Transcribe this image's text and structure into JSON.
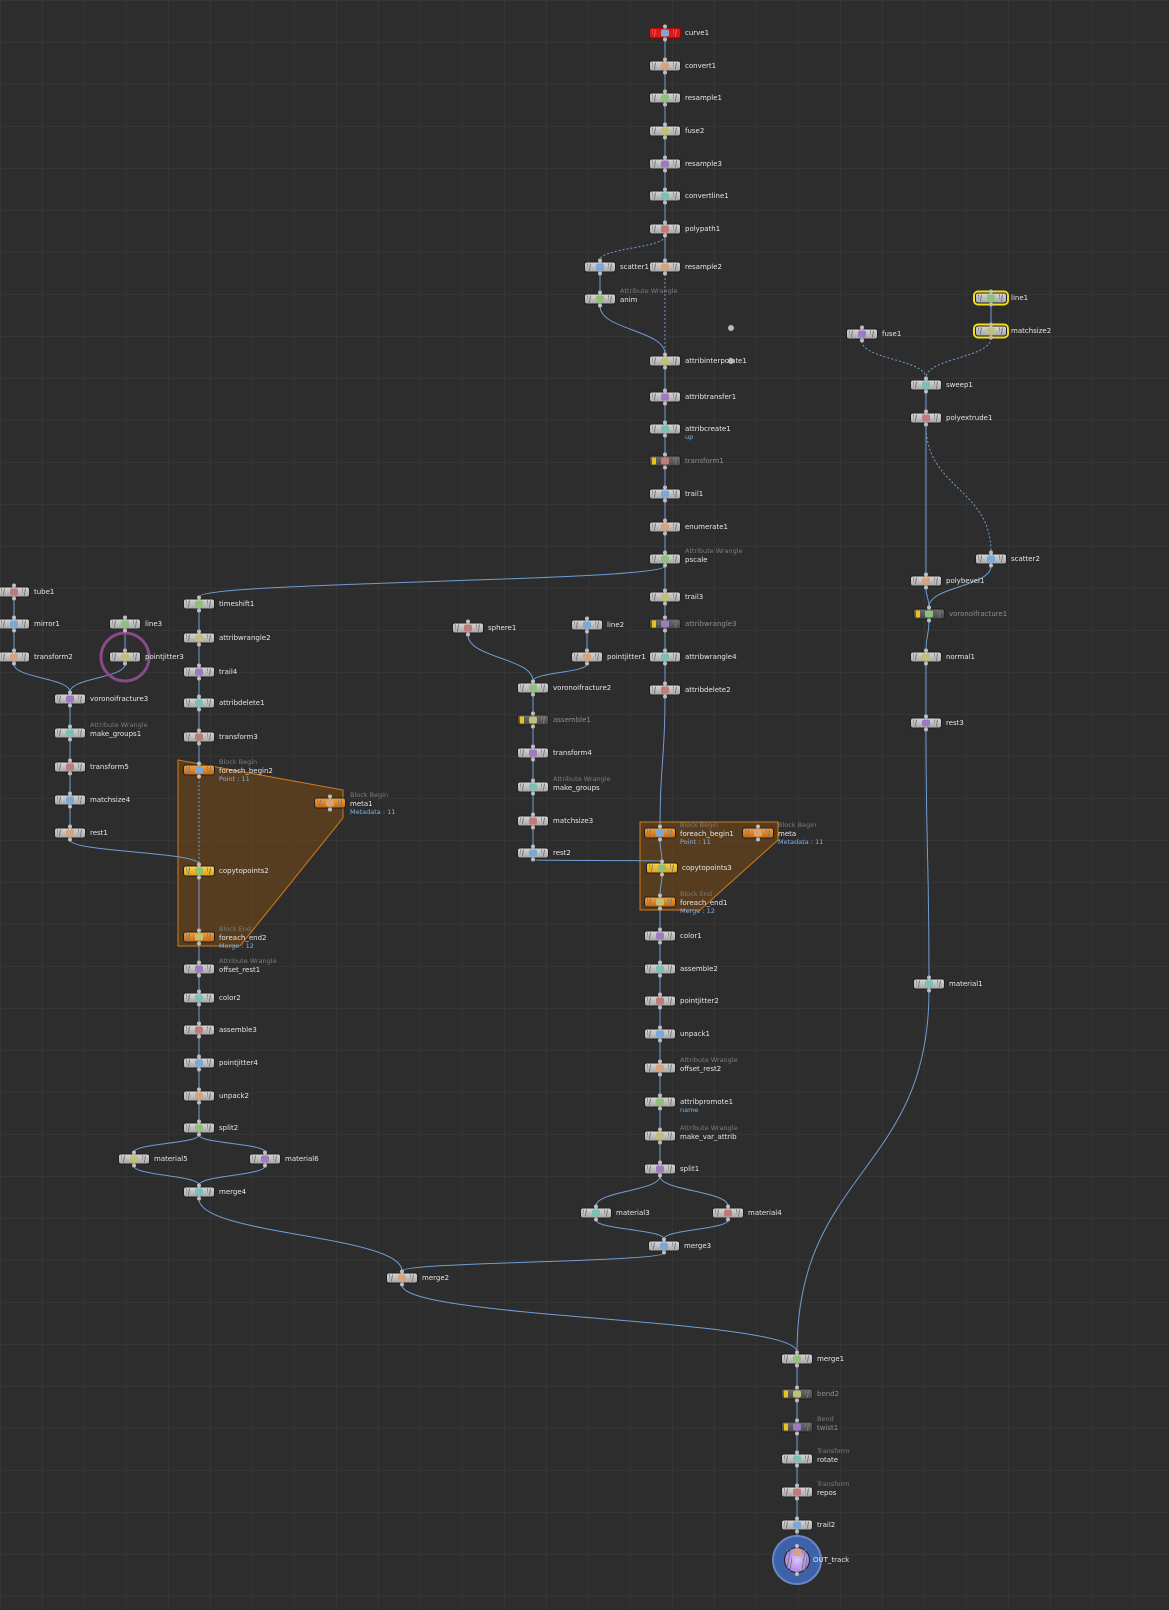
{
  "network": {
    "nodes": [
      {
        "id": "curve1",
        "label": "curve1",
        "style": "red"
      },
      {
        "id": "convert1",
        "label": "convert1"
      },
      {
        "id": "resample1",
        "label": "resample1"
      },
      {
        "id": "fuse2",
        "label": "fuse2"
      },
      {
        "id": "resample3",
        "label": "resample3"
      },
      {
        "id": "convertline1",
        "label": "convertline1"
      },
      {
        "id": "polypath1",
        "label": "polypath1"
      },
      {
        "id": "scatter1",
        "label": "scatter1"
      },
      {
        "id": "resample2",
        "label": "resample2"
      },
      {
        "id": "anim",
        "label": "anim",
        "type": "Attribute Wrangle"
      },
      {
        "id": "attribinterpolate1",
        "label": "attribinterpolate1"
      },
      {
        "id": "attribtransfer1",
        "label": "attribtransfer1"
      },
      {
        "id": "attribcreate1",
        "label": "attribcreate1",
        "sub": "up"
      },
      {
        "id": "transform1",
        "label": "transform1",
        "bypass": true
      },
      {
        "id": "trail1",
        "label": "trail1"
      },
      {
        "id": "enumerate1",
        "label": "enumerate1"
      },
      {
        "id": "pscale",
        "label": "pscale",
        "type": "Attribute Wrangle"
      },
      {
        "id": "trail3",
        "label": "trail3"
      },
      {
        "id": "attribwrangle3",
        "label": "attribwrangle3",
        "bypass": true
      },
      {
        "id": "attribwrangle4",
        "label": "attribwrangle4"
      },
      {
        "id": "attribdelete2",
        "label": "attribdelete2"
      },
      {
        "id": "foreach_begin1",
        "label": "foreach_begin1",
        "type": "Block Begin",
        "sub": "Point : 11",
        "style": "orange"
      },
      {
        "id": "meta",
        "label": "meta",
        "type": "Block Begin",
        "sub": "Metadata : 11",
        "style": "orange"
      },
      {
        "id": "copytopoints3",
        "label": "copytopoints3",
        "style": "yellow"
      },
      {
        "id": "foreach_end1",
        "label": "foreach_end1",
        "type": "Block End",
        "sub": "Merge : 12",
        "style": "orange"
      },
      {
        "id": "color1",
        "label": "color1"
      },
      {
        "id": "assemble2",
        "label": "assemble2"
      },
      {
        "id": "pointjitter2",
        "label": "pointjitter2"
      },
      {
        "id": "unpack1",
        "label": "unpack1"
      },
      {
        "id": "offset_rest2",
        "label": "offset_rest2",
        "type": "Attribute Wrangle"
      },
      {
        "id": "attribpromote1",
        "label": "attribpromote1",
        "sub": "name"
      },
      {
        "id": "make_var_attrib",
        "label": "make_var_attrib",
        "type": "Attribute Wrangle"
      },
      {
        "id": "split1",
        "label": "split1"
      },
      {
        "id": "material3",
        "label": "material3"
      },
      {
        "id": "material4",
        "label": "material4"
      },
      {
        "id": "merge3",
        "label": "merge3"
      },
      {
        "id": "merge2",
        "label": "merge2"
      },
      {
        "id": "merge1",
        "label": "merge1"
      },
      {
        "id": "bend2",
        "label": "bend2",
        "bypass": true
      },
      {
        "id": "twist1",
        "label": "twist1",
        "type": "Bend",
        "bypass": true
      },
      {
        "id": "rotate",
        "label": "rotate",
        "type": "Transform"
      },
      {
        "id": "repos",
        "label": "repos",
        "type": "Transform"
      },
      {
        "id": "trail2",
        "label": "trail2"
      },
      {
        "id": "OUT_track",
        "label": "OUT_track"
      },
      {
        "id": "line1",
        "label": "line1",
        "selected": true
      },
      {
        "id": "matchsize2",
        "label": "matchsize2",
        "selected": true
      },
      {
        "id": "fuse1",
        "label": "fuse1"
      },
      {
        "id": "sweep1",
        "label": "sweep1"
      },
      {
        "id": "polyextrude1",
        "label": "polyextrude1"
      },
      {
        "id": "scatter2",
        "label": "scatter2"
      },
      {
        "id": "polybevel1",
        "label": "polybevel1"
      },
      {
        "id": "voronoifracture1",
        "label": "voronoifracture1",
        "bypass": true
      },
      {
        "id": "normal1",
        "label": "normal1"
      },
      {
        "id": "rest3",
        "label": "rest3"
      },
      {
        "id": "material1",
        "label": "material1"
      },
      {
        "id": "tube1",
        "label": "tube1"
      },
      {
        "id": "mirror1",
        "label": "mirror1"
      },
      {
        "id": "transform2",
        "label": "transform2"
      },
      {
        "id": "line3",
        "label": "line3"
      },
      {
        "id": "pointjitter3",
        "label": "pointjitter3"
      },
      {
        "id": "voronoifracture3",
        "label": "voronoifracture3"
      },
      {
        "id": "make_groups1",
        "label": "make_groups1",
        "type": "Attribute Wrangle"
      },
      {
        "id": "transform5",
        "label": "transform5"
      },
      {
        "id": "matchsize4",
        "label": "matchsize4"
      },
      {
        "id": "rest1",
        "label": "rest1"
      },
      {
        "id": "timeshift1",
        "label": "timeshift1"
      },
      {
        "id": "attribwrangle2",
        "label": "attribwrangle2"
      },
      {
        "id": "trail4",
        "label": "trail4"
      },
      {
        "id": "attribdelete1",
        "label": "attribdelete1"
      },
      {
        "id": "transform3",
        "label": "transform3"
      },
      {
        "id": "foreach_begin2",
        "label": "foreach_begin2",
        "type": "Block Begin",
        "sub": "Point : 11",
        "style": "orange"
      },
      {
        "id": "meta1",
        "label": "meta1",
        "type": "Block Begin",
        "sub": "Metadata : 11",
        "style": "orange"
      },
      {
        "id": "copytopoints2",
        "label": "copytopoints2",
        "style": "yellow"
      },
      {
        "id": "foreach_end2",
        "label": "foreach_end2",
        "type": "Block End",
        "sub": "Merge : 12",
        "style": "orange"
      },
      {
        "id": "offset_rest1",
        "label": "offset_rest1",
        "type": "Attribute Wrangle"
      },
      {
        "id": "color2",
        "label": "color2"
      },
      {
        "id": "assemble3",
        "label": "assemble3"
      },
      {
        "id": "pointjitter4",
        "label": "pointjitter4"
      },
      {
        "id": "unpack2",
        "label": "unpack2"
      },
      {
        "id": "split2",
        "label": "split2"
      },
      {
        "id": "material5",
        "label": "material5"
      },
      {
        "id": "material6",
        "label": "material6"
      },
      {
        "id": "merge4",
        "label": "merge4"
      },
      {
        "id": "sphere1",
        "label": "sphere1"
      },
      {
        "id": "line2",
        "label": "line2"
      },
      {
        "id": "pointjitter1",
        "label": "pointjitter1"
      },
      {
        "id": "voronoifracture2",
        "label": "voronoifracture2"
      },
      {
        "id": "assemble1",
        "label": "assemble1",
        "bypass": true
      },
      {
        "id": "transform4",
        "label": "transform4"
      },
      {
        "id": "make_groups",
        "label": "make_groups",
        "type": "Attribute Wrangle"
      },
      {
        "id": "matchsize3",
        "label": "matchsize3"
      },
      {
        "id": "rest2",
        "label": "rest2"
      }
    ]
  },
  "colors": {
    "background": "#2d2d2d",
    "wire": "#6f9ed6",
    "block_fill": "#7a4a14",
    "block_stroke": "#d07a1c",
    "selection": "#f3e11a",
    "output": "#8a5fd0"
  },
  "icons": [
    "node-icon",
    "output-node-icon"
  ]
}
